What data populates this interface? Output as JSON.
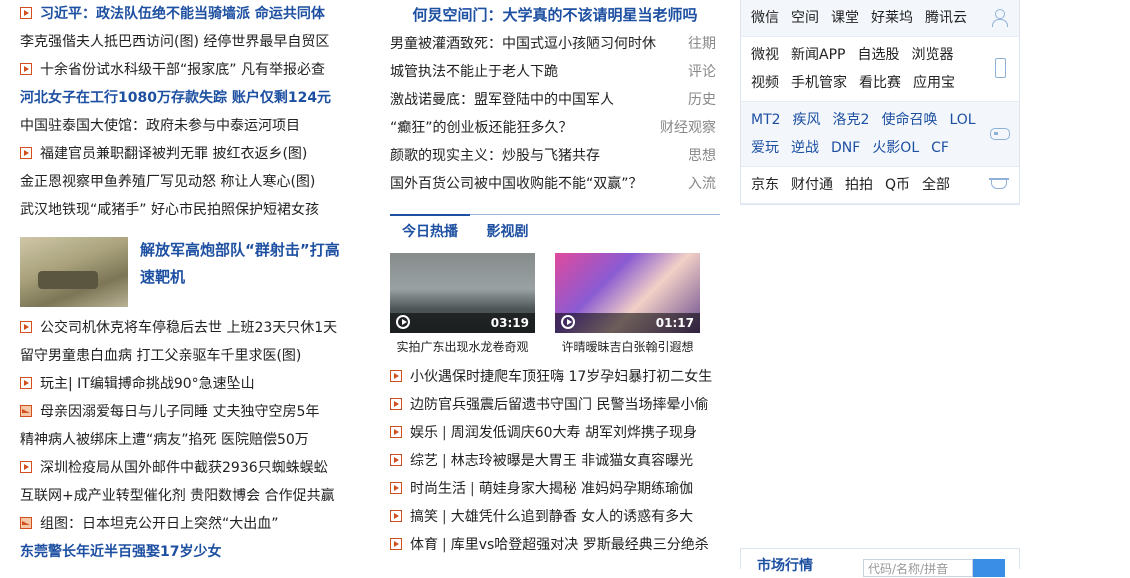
{
  "left": {
    "top_rows": [
      {
        "text": "习近平：政法队伍绝不能当骑墙派  命运共同体",
        "icon": "play-square",
        "style": "blue"
      },
      {
        "text": "李克强偕夫人抵巴西访问(图)  经停世界最早自贸区",
        "icon": "",
        "style": ""
      },
      {
        "text": "十余省份试水科级干部“报家底”  凡有举报必查",
        "icon": "play-square",
        "style": ""
      },
      {
        "text": "河北女子在工行1080万存款失踪 账户仅剩124元",
        "icon": "",
        "style": "blue"
      },
      {
        "text": "中国驻泰国大使馆：政府未参与中泰运河项目",
        "icon": "",
        "style": ""
      },
      {
        "text": "福建官员兼职翻译被判无罪  披红衣返乡(图)",
        "icon": "play-square",
        "style": ""
      },
      {
        "text": "金正恩视察甲鱼养殖厂写见动怒  称让人寒心(图)",
        "icon": "",
        "style": ""
      },
      {
        "text": "武汉地铁现“咸猪手”  好心市民拍照保护短裙女孩",
        "icon": "",
        "style": ""
      }
    ],
    "feature": {
      "title": "解放军高炮部队“群射击”打高速靶机"
    },
    "rows2": [
      {
        "text": "公交司机休克将车停稳后去世  上班23天只休1天",
        "icon": "play-square"
      },
      {
        "text": "留守男童患白血病  打工父亲驱车千里求医(图)",
        "icon": ""
      },
      {
        "text": "玩主|  IT编辑搏命挑战90°急速坠山",
        "icon": "play-square"
      },
      {
        "text": "母亲因溺爱每日与儿子同睡  丈夫独守空房5年",
        "icon": "picture"
      },
      {
        "text": "精神病人被绑床上遭“病友”掐死  医院赔偿50万",
        "icon": ""
      },
      {
        "text": "深圳检疫局从国外邮件中截获2936只蜘蛛蜈蚣",
        "icon": "play-square"
      },
      {
        "text": "互联网+成产业转型催化剂  贵阳数博会  合作促共赢",
        "icon": ""
      },
      {
        "text": "组图：日本坦克公开日上突然“大出血”",
        "icon": "picture"
      },
      {
        "text": "东莞警长年近半百强娶17岁少女",
        "icon": "",
        "style": "blue"
      }
    ]
  },
  "mid": {
    "headline": "何炅空间门：大学真的不该请明星当老师吗",
    "rows": [
      {
        "text": "男童被灌酒致死：中国式逗小孩陋习何时休",
        "cat": "往期"
      },
      {
        "text": "城管执法不能止于老人下跪",
        "cat": "评论"
      },
      {
        "text": "激战诺曼底：盟军登陆中的中国军人",
        "cat": "历史"
      },
      {
        "text": "“癫狂”的创业板还能狂多久？",
        "cat": "财经观察"
      },
      {
        "text": "颜歌的现实主义：炒股与飞猪共存",
        "cat": "思想"
      },
      {
        "text": "国外百货公司被中国收购能不能“双赢”？",
        "cat": "入流"
      }
    ],
    "tabs": [
      "今日热播",
      "影视剧"
    ],
    "videos": [
      {
        "duration": "03:19",
        "caption": "实拍广东出现水龙卷奇观"
      },
      {
        "duration": "01:17",
        "caption": "许晴暧昧吉白张翰引遐想"
      }
    ],
    "rows2": [
      {
        "cat": "",
        "text": "小伙遇保时捷爬车顶狂嗨  17岁孕妇暴打初二女生"
      },
      {
        "cat": "",
        "text": "边防官兵强震后留遗书守国门  民警当场摔晕小偷"
      },
      {
        "cat": "娱乐",
        "text": "周润发低调庆60大寿  胡军刘烨携子现身"
      },
      {
        "cat": "综艺",
        "text": "林志玲被曝是大胃王  非诚猫女真容曝光"
      },
      {
        "cat": "时尚生活",
        "text": "萌娃身家大揭秘  准妈妈孕期练瑜伽"
      },
      {
        "cat": "搞笑",
        "text": "大雄凭什么追到静香  女人的诱惑有多大"
      },
      {
        "cat": "体育",
        "text": "库里vs哈登超强对决  罗斯最经典三分绝杀"
      }
    ]
  },
  "right": {
    "groups": [
      {
        "icon": "user-icon",
        "rows": [
          [
            "微信",
            "空间",
            "课堂",
            "好莱坞",
            "腾讯云"
          ]
        ]
      },
      {
        "icon": "phone-icon",
        "rows": [
          [
            "微视",
            "新闻APP",
            "自选股",
            "浏览器"
          ],
          [
            "视频",
            "手机管家",
            "看比赛",
            "应用宝"
          ]
        ]
      },
      {
        "icon": "gamepad-icon",
        "rows": [
          [
            "MT2",
            "疾风",
            "洛克2",
            "使命召唤",
            "LOL"
          ],
          [
            "爱玩",
            "逆战",
            "DNF",
            "火影OL",
            "CF"
          ]
        ]
      },
      {
        "icon": "cup-icon",
        "rows": [
          [
            "京东",
            "财付通",
            "拍拍",
            "Q币",
            "全部"
          ]
        ]
      }
    ]
  },
  "market": {
    "title": "市场行情",
    "placeholder": "代码/名称/拼音"
  }
}
